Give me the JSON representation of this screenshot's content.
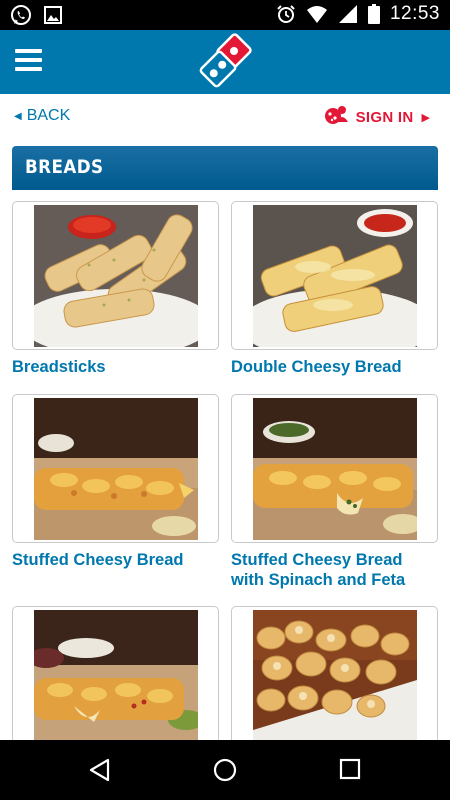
{
  "status_bar": {
    "time": "12:53",
    "left_icons": [
      "whatsapp-icon",
      "image-icon"
    ],
    "right_icons": [
      "alarm-icon",
      "wifi-icon",
      "signal-icon",
      "battery-icon"
    ]
  },
  "header": {
    "menu_icon": "hamburger-menu-icon",
    "logo": "dominos-logo",
    "brand_colors": {
      "blue": "#0078ae",
      "red": "#e31837"
    }
  },
  "nav": {
    "back_label": "BACK",
    "sign_in_label": "SIGN IN"
  },
  "section": {
    "title": "BREADS"
  },
  "products": [
    {
      "name": "Breadsticks"
    },
    {
      "name": "Double Cheesy Bread"
    },
    {
      "name": "Stuffed Cheesy Bread"
    },
    {
      "name": "Stuffed Cheesy Bread with Spinach and Feta"
    },
    {
      "name": ""
    },
    {
      "name": ""
    }
  ],
  "system_nav": [
    "back-triangle-icon",
    "home-circle-icon",
    "recents-square-icon"
  ]
}
